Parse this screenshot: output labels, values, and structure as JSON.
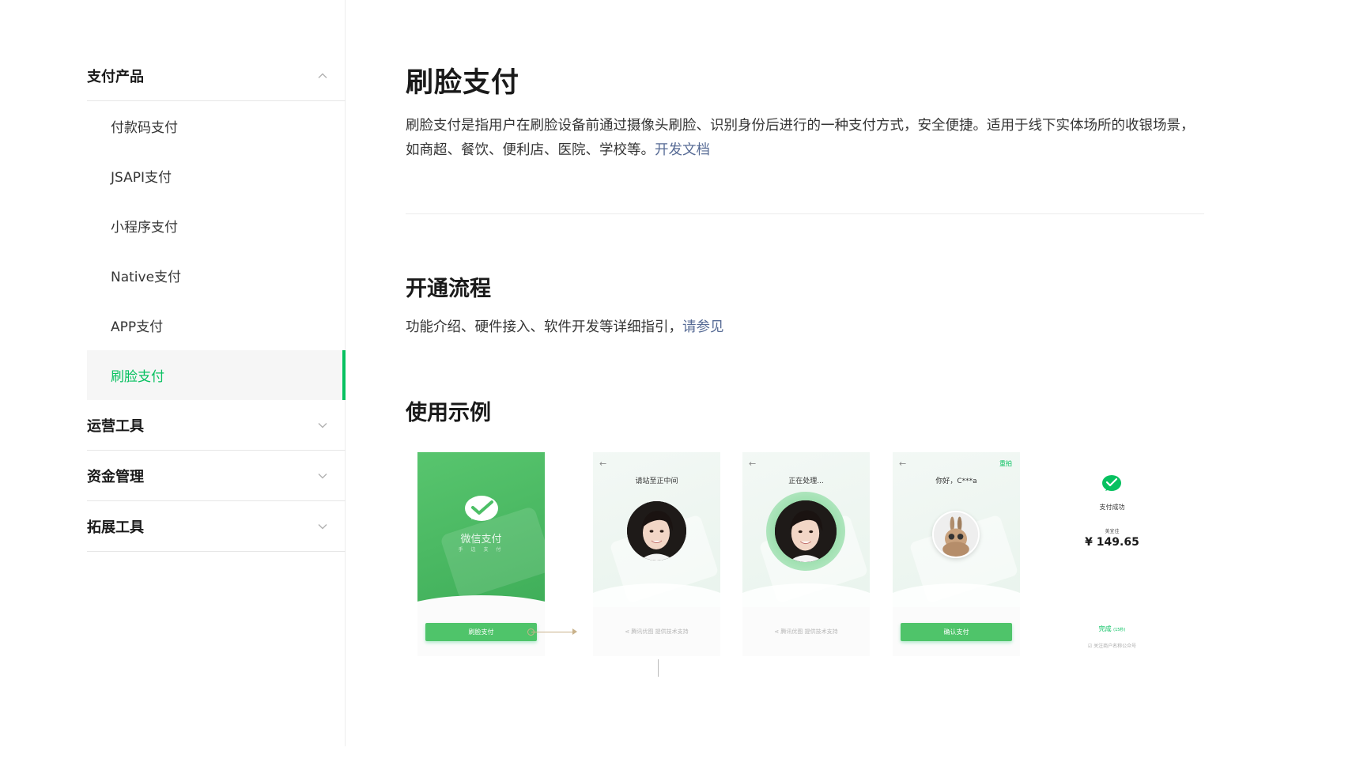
{
  "colors": {
    "accent": "#07c160",
    "link": "#576b95",
    "text": "#353535"
  },
  "sidebar": {
    "groups": [
      {
        "title": "支付产品",
        "expanded": true,
        "items": [
          {
            "label": "付款码支付"
          },
          {
            "label": "JSAPI支付"
          },
          {
            "label": "小程序支付"
          },
          {
            "label": "Native支付"
          },
          {
            "label": "APP支付"
          },
          {
            "label": "刷脸支付",
            "active": true
          }
        ]
      },
      {
        "title": "运营工具",
        "expanded": false
      },
      {
        "title": "资金管理",
        "expanded": false
      },
      {
        "title": "拓展工具",
        "expanded": false
      }
    ]
  },
  "main": {
    "title": "刷脸支付",
    "description": "刷脸支付是指用户在刷脸设备前通过摄像头刷脸、识别身份后进行的一种支付方式，安全便捷。适用于线下实体场所的收银场景，如商超、餐饮、便利店、医院、学校等。",
    "description_link": "开发文档",
    "flow": {
      "heading": "开通流程",
      "text": "功能介绍、硬件接入、软件开发等详细指引，",
      "link": "请参见"
    },
    "example": {
      "heading": "使用示例",
      "screens": {
        "splash": {
          "title": "微信支付",
          "subtitle": "手 边 支 付",
          "button": "刷脸支付"
        },
        "align": {
          "title": "请站至正中间",
          "footer": "腾讯优图 提供技术支持"
        },
        "processing": {
          "title": "正在处理...",
          "footer": "腾讯优图 提供技术支持"
        },
        "confirm": {
          "title": "你好，C***a",
          "retake": "重拍",
          "button": "确认支付"
        },
        "success": {
          "status": "支付成功",
          "merchant": "美宜佳",
          "amount": "¥ 149.65",
          "done": "完成",
          "countdown": "(15秒)",
          "follow": "关注商户名称公众号"
        }
      }
    }
  }
}
